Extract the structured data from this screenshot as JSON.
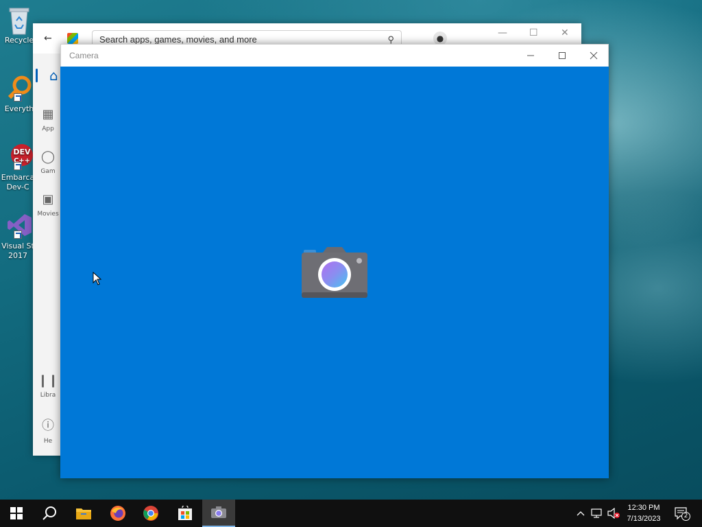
{
  "desktop": {
    "icons": [
      {
        "label": "Recycle",
        "icon": "recycle-bin-icon"
      },
      {
        "label": "Everyth",
        "icon": "everything-search-icon"
      },
      {
        "label": "Embarca Dev-C",
        "icon": "dev-cpp-icon"
      },
      {
        "label": "Visual St 2017",
        "icon": "visual-studio-icon"
      }
    ]
  },
  "store": {
    "search_placeholder": "Search apps, games, movies, and more",
    "nav": [
      {
        "label": "App",
        "icon": "apps-icon"
      },
      {
        "label": "Gam",
        "icon": "gaming-icon"
      },
      {
        "label": "Movies",
        "icon": "movies-icon"
      },
      {
        "label": "Libra",
        "icon": "library-icon"
      },
      {
        "label": "He",
        "icon": "help-icon"
      }
    ]
  },
  "camera": {
    "title": "Camera",
    "center_icon": "camera-icon"
  },
  "taskbar": {
    "apps": [
      "start-icon",
      "search-icon",
      "file-explorer-icon",
      "firefox-icon",
      "chrome-icon",
      "store-icon",
      "camera-icon"
    ],
    "time": "12:30 PM",
    "date": "7/13/2023",
    "notification_count": "2",
    "accent": "#0078d7"
  }
}
